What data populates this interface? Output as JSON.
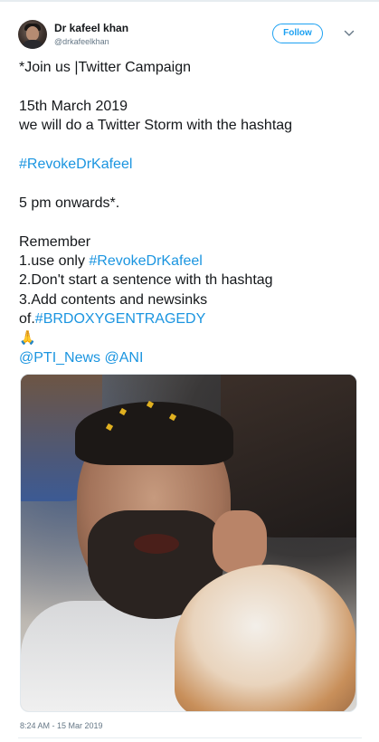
{
  "author": {
    "name": "Dr kafeel khan",
    "handle": "@drkafeelkhan"
  },
  "header": {
    "follow_label": "Follow",
    "menu_icon": "chevron-down-icon"
  },
  "tweet": {
    "line1": "*Join us |Twitter Campaign",
    "line2": "15th March 2019",
    "line3": "we will do a Twitter Storm with the hashtag",
    "hashtag1": "#RevokeDrKafeel",
    "line4": "5 pm onwards*.",
    "line5": "Remember",
    "rule1_prefix": "1.use only ",
    "rule1_hashtag": "#RevokeDrKafeel",
    "rule2": "2.Don't start a sentence with th hashtag",
    "rule3": "3.Add contents and newsinks",
    "rule3b_prefix": "of.",
    "rule3b_hashtag": "#BRDOXYGENTRAGEDY",
    "emoji": "🙏",
    "mention1": "@PTI_News",
    "mention2": "@ANI"
  },
  "timestamp": "8:24 AM - 15 Mar 2019",
  "colors": {
    "link": "#1b95e0",
    "follow_border": "#1da1f2",
    "secondary_text": "#657786"
  }
}
